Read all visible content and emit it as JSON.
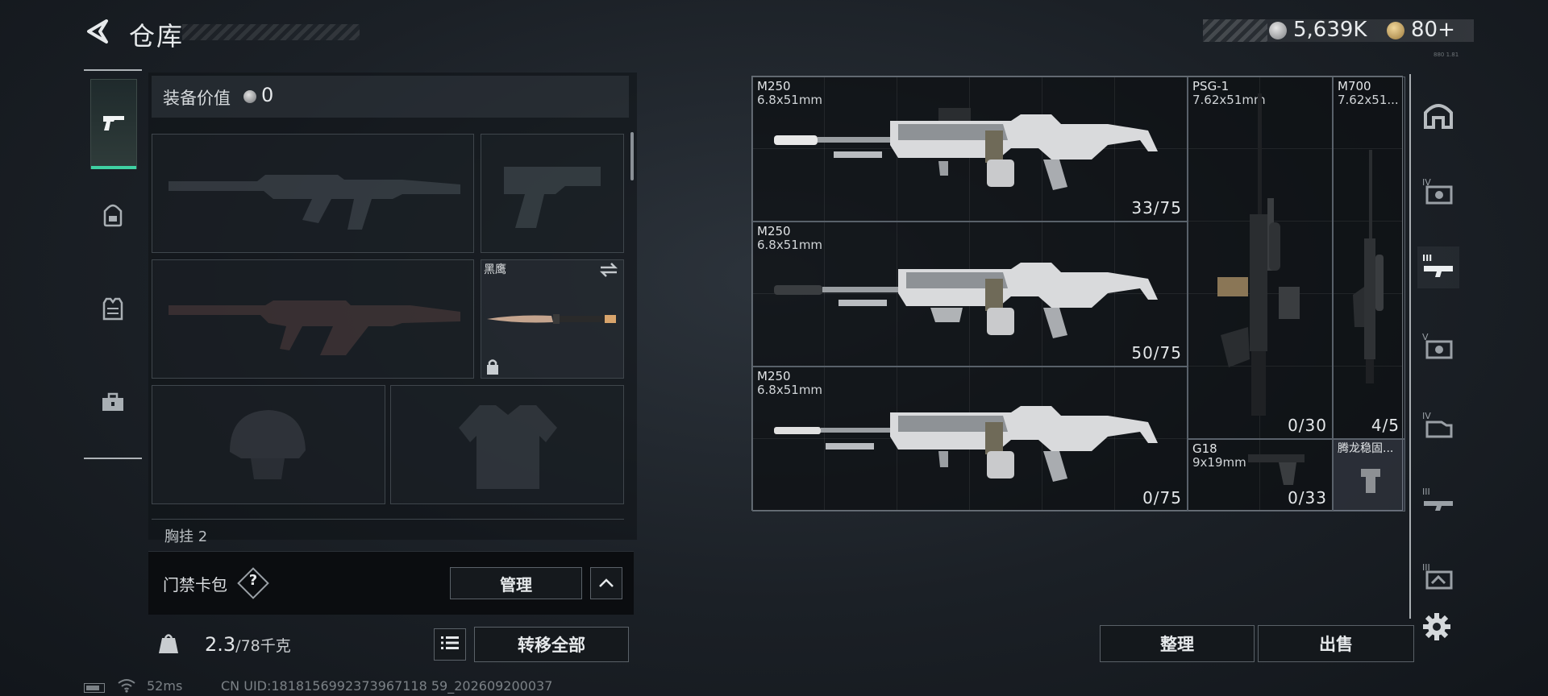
{
  "header": {
    "back_icon": "back-arrow-icon",
    "title": "仓库",
    "currency_silver": "5,639K",
    "currency_gold": "80+",
    "build_tag": "880 1.81"
  },
  "loadout": {
    "value_label": "装备价值",
    "value_amount": "0",
    "melee_name": "黑鹰",
    "chest_label": "胸挂",
    "chest_count": "2"
  },
  "left_tabs": [
    {
      "icon": "pistol-icon",
      "active": true
    },
    {
      "icon": "backpack-icon",
      "active": false
    },
    {
      "icon": "vest-icon",
      "active": false
    },
    {
      "icon": "toolbox-icon",
      "active": false
    }
  ],
  "keycard": {
    "label": "门禁卡包",
    "help": "?",
    "manage_label": "管理"
  },
  "weight": {
    "current": "2.3",
    "max": "/78千克"
  },
  "transfer_all_label": "转移全部",
  "status": {
    "ping": "52ms",
    "uid": "CN UID:1818156992373967118 59_202609200037"
  },
  "stash": {
    "items": [
      {
        "name": "M250",
        "caliber": "6.8x51mm",
        "ammo": "33/75"
      },
      {
        "name": "M250",
        "caliber": "6.8x51mm",
        "ammo": "50/75"
      },
      {
        "name": "M250",
        "caliber": "6.8x51mm",
        "ammo": "0/75"
      },
      {
        "name": "PSG-1",
        "caliber": "7.62x51mm",
        "ammo": "0/30"
      },
      {
        "name": "M700",
        "caliber": "7.62x51...",
        "ammo": "4/5"
      },
      {
        "name": "G18",
        "caliber": "9x19mm",
        "ammo": "0/33"
      },
      {
        "name": "腾龙稳固...",
        "caliber": "",
        "ammo": ""
      }
    ]
  },
  "filters": [
    {
      "icon": "all-items-icon"
    },
    {
      "icon": "tier-4-helmet-icon",
      "tier": "IV"
    },
    {
      "icon": "tier-3-gun-icon",
      "tier": "III",
      "active": true
    },
    {
      "icon": "tier-5-case-icon",
      "tier": "V"
    },
    {
      "icon": "tier-4-card-icon",
      "tier": "IV"
    },
    {
      "icon": "tier-3-rifle-icon",
      "tier": "III"
    },
    {
      "icon": "tier-3-box-icon",
      "tier": "III"
    }
  ],
  "actions": {
    "sort_label": "整理",
    "sell_label": "出售"
  },
  "colors": {
    "accent": "#3fd1a2",
    "panel_border": "#59616a",
    "text": "#e3e6e8"
  }
}
